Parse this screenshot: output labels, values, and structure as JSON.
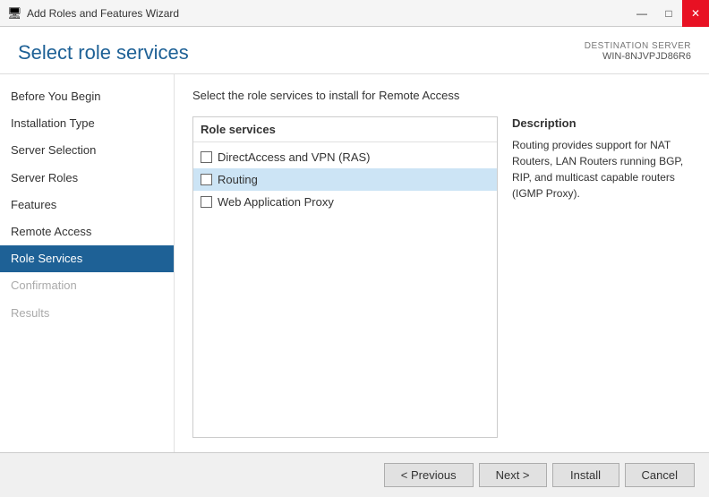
{
  "titlebar": {
    "title": "Add Roles and Features Wizard",
    "icon": "⚙",
    "minimize": "—",
    "maximize": "□",
    "close": "✕"
  },
  "header": {
    "title": "Select role services",
    "dest_server_label": "DESTINATION SERVER",
    "dest_server_name": "WIN-8NJVPJD86R6"
  },
  "sidebar": {
    "items": [
      {
        "id": "before-you-begin",
        "label": "Before You Begin",
        "state": "normal"
      },
      {
        "id": "installation-type",
        "label": "Installation Type",
        "state": "normal"
      },
      {
        "id": "server-selection",
        "label": "Server Selection",
        "state": "normal"
      },
      {
        "id": "server-roles",
        "label": "Server Roles",
        "state": "normal"
      },
      {
        "id": "features",
        "label": "Features",
        "state": "normal"
      },
      {
        "id": "remote-access",
        "label": "Remote Access",
        "state": "normal"
      },
      {
        "id": "role-services",
        "label": "Role Services",
        "state": "active"
      },
      {
        "id": "confirmation",
        "label": "Confirmation",
        "state": "disabled"
      },
      {
        "id": "results",
        "label": "Results",
        "state": "disabled"
      }
    ]
  },
  "main": {
    "instruction": "Select the role services to install for Remote Access",
    "role_services_header": "Role services",
    "services": [
      {
        "id": "directaccess-vpn",
        "label": "DirectAccess and VPN (RAS)",
        "checked": false,
        "selected": false
      },
      {
        "id": "routing",
        "label": "Routing",
        "checked": false,
        "selected": true
      },
      {
        "id": "web-application-proxy",
        "label": "Web Application Proxy",
        "checked": false,
        "selected": false
      }
    ],
    "description": {
      "title": "Description",
      "text": "Routing provides support for NAT Routers, LAN Routers running BGP, RIP, and multicast capable routers (IGMP Proxy)."
    }
  },
  "footer": {
    "previous_label": "< Previous",
    "next_label": "Next >",
    "install_label": "Install",
    "cancel_label": "Cancel"
  }
}
